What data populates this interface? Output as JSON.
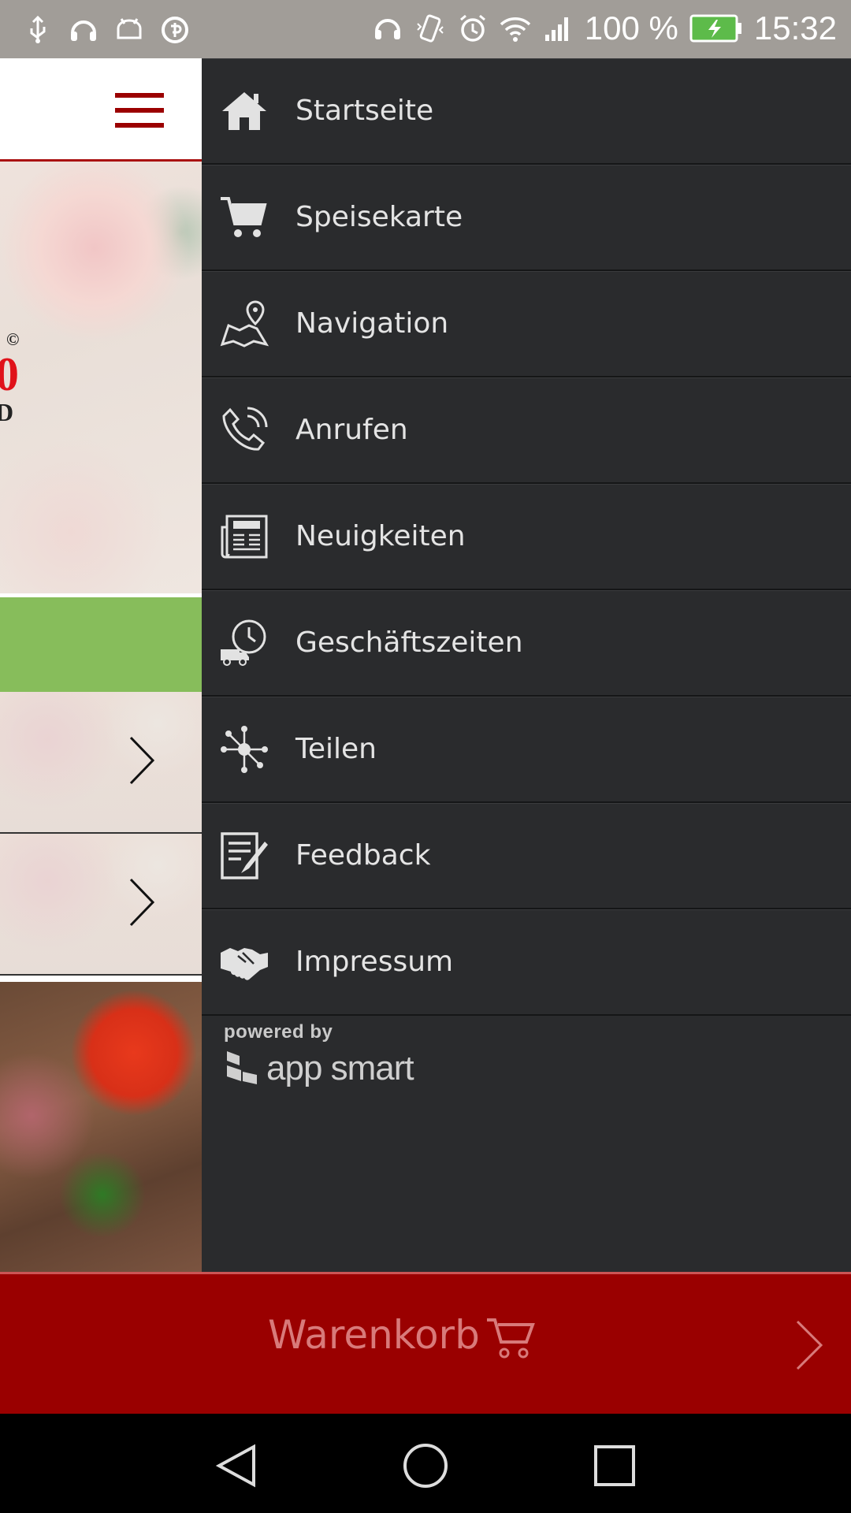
{
  "status_bar": {
    "battery_percent": "100 %",
    "time": "15:32"
  },
  "app": {
    "hero_fragments": [
      "©",
      "0",
      "D"
    ]
  },
  "drawer": {
    "items": [
      {
        "label": "Startseite",
        "icon": "home-icon"
      },
      {
        "label": "Speisekarte",
        "icon": "cart-icon"
      },
      {
        "label": "Navigation",
        "icon": "map-pin-icon"
      },
      {
        "label": "Anrufen",
        "icon": "phone-icon"
      },
      {
        "label": "Neuigkeiten",
        "icon": "news-icon"
      },
      {
        "label": "Geschäftszeiten",
        "icon": "delivery-clock-icon"
      },
      {
        "label": "Teilen",
        "icon": "share-network-icon"
      },
      {
        "label": "Feedback",
        "icon": "feedback-form-icon"
      },
      {
        "label": "Impressum",
        "icon": "handshake-icon"
      }
    ],
    "powered_by": "powered by",
    "brand": "app smart"
  },
  "cart": {
    "label": "Warenkorb"
  },
  "colors": {
    "drawer_bg": "#2a2b2d",
    "accent_red": "#9a0000",
    "green": "#87bd5b"
  }
}
